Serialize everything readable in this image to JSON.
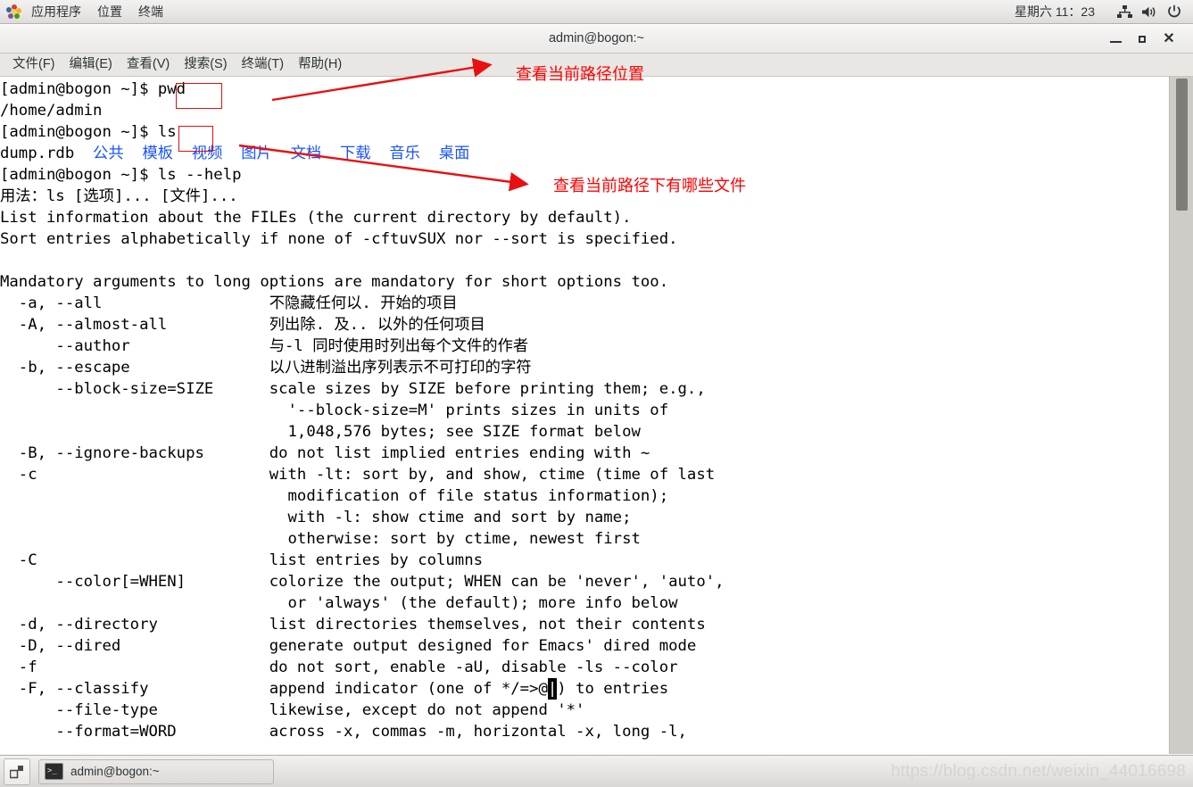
{
  "desktop_panel": {
    "menus": [
      "应用程序",
      "位置",
      "终端"
    ],
    "clock": "星期六 11：23",
    "tray": [
      "network-icon",
      "volume-icon",
      "power-icon"
    ]
  },
  "window": {
    "title": "admin@bogon:~",
    "buttons": {
      "minimize": "minimize-button",
      "maximize": "maximize-button",
      "close": "close-button"
    },
    "menubar": [
      "文件(F)",
      "编辑(E)",
      "查看(V)",
      "搜索(S)",
      "终端(T)",
      "帮助(H)"
    ]
  },
  "terminal": {
    "lines": [
      {
        "text": "[admin@bogon ~]$ pwd"
      },
      {
        "text": "/home/admin"
      },
      {
        "text": "[admin@bogon ~]$ ls"
      },
      {
        "text": "dump.rdb  ",
        "dirs": [
          "公共",
          "模板",
          "视频",
          "图片",
          "文档",
          "下载",
          "音乐",
          "桌面"
        ]
      },
      {
        "text": "[admin@bogon ~]$ ls --help"
      },
      {
        "text": "用法：ls [选项]... [文件]..."
      },
      {
        "text": "List information about the FILEs (the current directory by default)."
      },
      {
        "text": "Sort entries alphabetically if none of -cftuvSUX nor --sort is specified."
      },
      {
        "text": ""
      },
      {
        "text": "Mandatory arguments to long options are mandatory for short options too."
      },
      {
        "text": "  -a, --all                  不隐藏任何以. 开始的项目"
      },
      {
        "text": "  -A, --almost-all           列出除. 及.. 以外的任何项目"
      },
      {
        "text": "      --author               与-l 同时使用时列出每个文件的作者"
      },
      {
        "text": "  -b, --escape               以八进制溢出序列表示不可打印的字符"
      },
      {
        "text": "      --block-size=SIZE      scale sizes by SIZE before printing them; e.g.,"
      },
      {
        "text": "                               '--block-size=M' prints sizes in units of"
      },
      {
        "text": "                               1,048,576 bytes; see SIZE format below"
      },
      {
        "text": "  -B, --ignore-backups       do not list implied entries ending with ~"
      },
      {
        "text": "  -c                         with -lt: sort by, and show, ctime (time of last"
      },
      {
        "text": "                               modification of file status information);"
      },
      {
        "text": "                               with -l: show ctime and sort by name;"
      },
      {
        "text": "                               otherwise: sort by ctime, newest first"
      },
      {
        "text": "  -C                         list entries by columns"
      },
      {
        "text": "      --color[=WHEN]         colorize the output; WHEN can be 'never', 'auto',"
      },
      {
        "text": "                               or 'always' (the default); more info below"
      },
      {
        "text": "  -d, --directory            list directories themselves, not their contents"
      },
      {
        "text": "  -D, --dired                generate output designed for Emacs' dired mode"
      },
      {
        "text": "  -f                         do not sort, enable -aU, disable -ls --color"
      },
      {
        "text": "  -F, --classify             append indicator (one of */=>@|) to entries"
      },
      {
        "text": "      --file-type            likewise, except do not append '*'"
      },
      {
        "text": "      --format=WORD          across -x, commas -m, horizontal -x, long -l,"
      }
    ]
  },
  "annotations": {
    "boxes": [
      {
        "name": "pwd-highlight-box"
      },
      {
        "name": "ls-highlight-box"
      }
    ],
    "labels": [
      {
        "text": "查看当前路径位置"
      },
      {
        "text": "查看当前路径下有哪些文件"
      }
    ],
    "color": "#ff0000"
  },
  "taskbar": {
    "show_desktop": "show-desktop-button",
    "window_button": "admin@bogon:~",
    "watermark": "https://blog.csdn.net/weixin_44016698"
  }
}
